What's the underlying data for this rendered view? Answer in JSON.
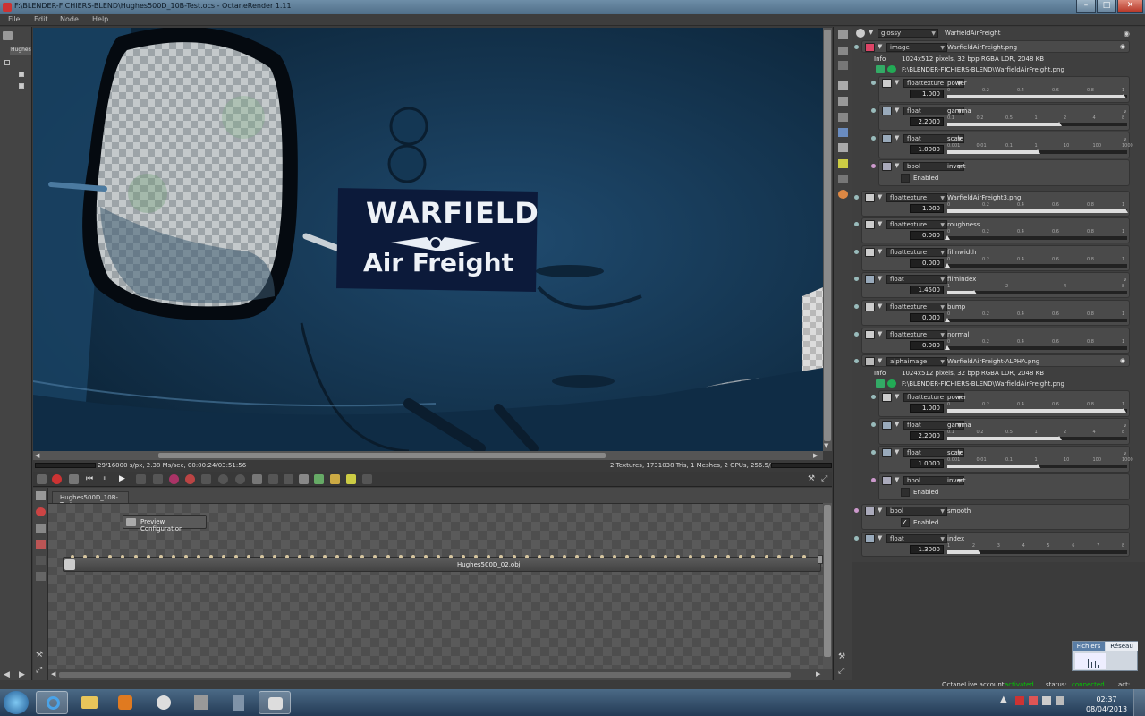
{
  "window": {
    "title": "F:\\BLENDER-FICHIERS-BLEND\\Hughes500D_10B-Test.ocs - OctaneRender 1.11",
    "controls": [
      "–",
      "□",
      "✕"
    ]
  },
  "menu": [
    "File",
    "Edit",
    "Node",
    "Help"
  ],
  "left_tab": "HughesB",
  "viewport": {
    "sign_line1": "WARFIELD",
    "sign_line2": "Air Freight"
  },
  "status": {
    "left": "29/16000 s/px, 2.38 Ms/sec, 00:00:24/03:51:56",
    "right": "2 Textures, 1731038 Tris, 1 Meshes, 2 GPUs, 256.5/2866/3071 MB"
  },
  "node_editor": {
    "tab": "Hughes500D_10B-Test",
    "preview_button": "Preview Configuration",
    "mesh_node_label": "Hughes500D_02.obj"
  },
  "material": {
    "type": "glossy",
    "name": "WarfieldAirFreight",
    "rows": [
      {
        "type": "image",
        "label": "WarfieldAirFreight.png"
      },
      {
        "info_label": "Info",
        "info": "1024x512 pixels, 32 bpp RGBA LDR, 2048 KB",
        "path": "F:\\BLENDER-FICHIERS-BLEND\\WarfieldAirFreight.png"
      },
      {
        "type": "floattexture",
        "label": "power",
        "value": "1.000"
      },
      {
        "type": "float",
        "label": "gamma",
        "value": "2.2000"
      },
      {
        "type": "float",
        "label": "scale",
        "value": "1.0000"
      },
      {
        "type": "bool",
        "label": "invert",
        "check": "Enabled"
      },
      {
        "type": "floattexture",
        "label": "WarfieldAirFreight3.png",
        "value": "1.000"
      },
      {
        "type": "floattexture",
        "label": "roughness",
        "value": "0.000"
      },
      {
        "type": "floattexture",
        "label": "filmwidth",
        "value": "0.000"
      },
      {
        "type": "float",
        "label": "filmindex",
        "value": "1.4500"
      },
      {
        "type": "floattexture",
        "label": "bump",
        "value": "0.000"
      },
      {
        "type": "floattexture",
        "label": "normal",
        "value": "0.000"
      },
      {
        "type": "alphaimage",
        "label": "WarfieldAirFreight-ALPHA.png"
      },
      {
        "info_label": "Info",
        "info": "1024x512 pixels, 32 bpp RGBA LDR, 2048 KB",
        "path": "F:\\BLENDER-FICHIERS-BLEND\\WarfieldAirFreight.png"
      },
      {
        "type": "floattexture",
        "label": "power",
        "value": "1.000"
      },
      {
        "type": "float",
        "label": "gamma",
        "value": "2.2000"
      },
      {
        "type": "float",
        "label": "scale",
        "value": "1.0000"
      },
      {
        "type": "bool",
        "label": "invert",
        "check": "Enabled"
      },
      {
        "type": "bool",
        "label": "smooth",
        "check": "Enabled"
      },
      {
        "type": "float",
        "label": "index",
        "value": "1.3000"
      }
    ],
    "ticks_01": [
      "0",
      "0.2",
      "0.4",
      "0.6",
      "0.8",
      "1"
    ],
    "ticks_gamma": [
      "0.1",
      "0.2",
      "0.5",
      "1",
      "2",
      "4",
      "8"
    ],
    "ticks_scale": [
      "0.001",
      "0.01",
      "0.1",
      "1",
      "10",
      "100",
      "1000"
    ],
    "ticks_filmindex": [
      "1",
      "2",
      "4",
      "8"
    ],
    "ticks_index": [
      "1",
      "2",
      "3",
      "4",
      "5",
      "6",
      "7",
      "8"
    ]
  },
  "fichiers_box": {
    "tab1": "Fichiers",
    "tab2": "Réseau"
  },
  "octanelive": {
    "account_label": "OctaneLive account:",
    "account_value": "activated",
    "status_label": "status:",
    "status_value": "connected",
    "act_label": "act:"
  },
  "clock": {
    "time": "02:37",
    "date": "08/04/2013"
  },
  "colors": {
    "accent_green": "#00d000",
    "panel": "#4a4a4a"
  }
}
